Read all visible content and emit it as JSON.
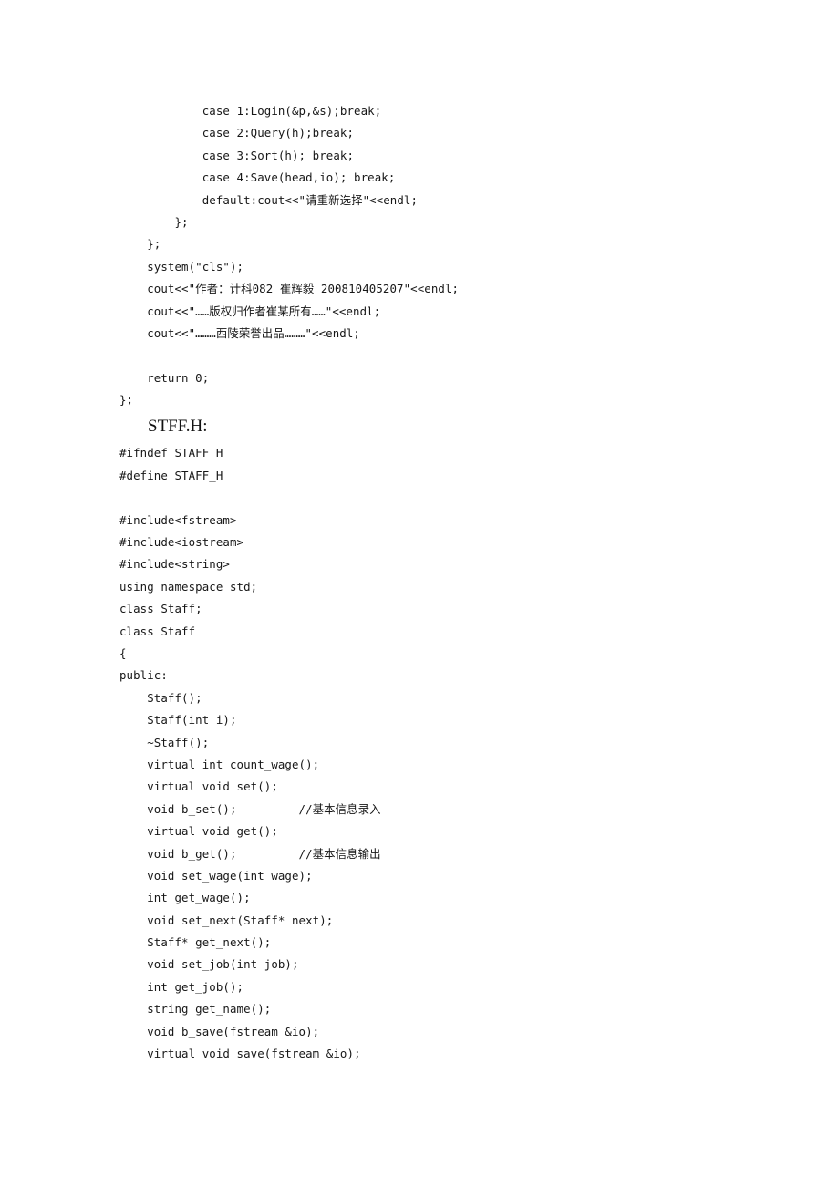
{
  "document": {
    "background_color": "#ffffff",
    "text_color": "#171717",
    "section_heading": "STFF.H:",
    "main_tail": {
      "lines": [
        {
          "indent": 12,
          "text": "case 1:Login(&p,&s);break;"
        },
        {
          "indent": 12,
          "text": "case 2:Query(h);break;"
        },
        {
          "indent": 12,
          "text": "case 3:Sort(h); break;"
        },
        {
          "indent": 12,
          "text": "case 4:Save(head,io); break;"
        },
        {
          "indent": 12,
          "text": "default:cout<<\"请重新选择\"<<endl;"
        },
        {
          "indent": 8,
          "text": "};"
        },
        {
          "indent": 4,
          "text": "};"
        },
        {
          "indent": 4,
          "text": "system(\"cls\");"
        },
        {
          "indent": 4,
          "text": "cout<<\"作者：计科082 崔辉毅 200810405207\"<<endl;"
        },
        {
          "indent": 4,
          "text": "cout<<\"……版权归作者崔某所有……\"<<endl;"
        },
        {
          "indent": 4,
          "text": "cout<<\"………西陵荣誉出品………\"<<endl;"
        },
        {
          "indent": 0,
          "text": ""
        },
        {
          "indent": 4,
          "text": "return 0;"
        },
        {
          "indent": 0,
          "text": "};"
        }
      ]
    },
    "staff_header": {
      "lines": [
        {
          "indent": 0,
          "text": "#ifndef STAFF_H"
        },
        {
          "indent": 0,
          "text": "#define STAFF_H"
        },
        {
          "indent": 0,
          "text": ""
        },
        {
          "indent": 0,
          "text": "#include<fstream>"
        },
        {
          "indent": 0,
          "text": "#include<iostream>"
        },
        {
          "indent": 0,
          "text": "#include<string>"
        },
        {
          "indent": 0,
          "text": "using namespace std;"
        },
        {
          "indent": 0,
          "text": "class Staff;"
        },
        {
          "indent": 0,
          "text": "class Staff"
        },
        {
          "indent": 0,
          "text": "{"
        },
        {
          "indent": 0,
          "text": "public:"
        },
        {
          "indent": 4,
          "text": "Staff();"
        },
        {
          "indent": 4,
          "text": "Staff(int i);"
        },
        {
          "indent": 4,
          "text": "~Staff();"
        },
        {
          "indent": 4,
          "text": "virtual int count_wage();"
        },
        {
          "indent": 4,
          "text": "virtual void set();"
        },
        {
          "indent": 4,
          "text": "void b_set();         //基本信息录入"
        },
        {
          "indent": 4,
          "text": "virtual void get();"
        },
        {
          "indent": 4,
          "text": "void b_get();         //基本信息输出"
        },
        {
          "indent": 4,
          "text": "void set_wage(int wage);"
        },
        {
          "indent": 4,
          "text": "int get_wage();"
        },
        {
          "indent": 4,
          "text": "void set_next(Staff* next);"
        },
        {
          "indent": 4,
          "text": "Staff* get_next();"
        },
        {
          "indent": 4,
          "text": "void set_job(int job);"
        },
        {
          "indent": 4,
          "text": "int get_job();"
        },
        {
          "indent": 4,
          "text": "string get_name();"
        },
        {
          "indent": 4,
          "text": "void b_save(fstream &io);"
        },
        {
          "indent": 4,
          "text": "virtual void save(fstream &io);"
        }
      ]
    }
  }
}
